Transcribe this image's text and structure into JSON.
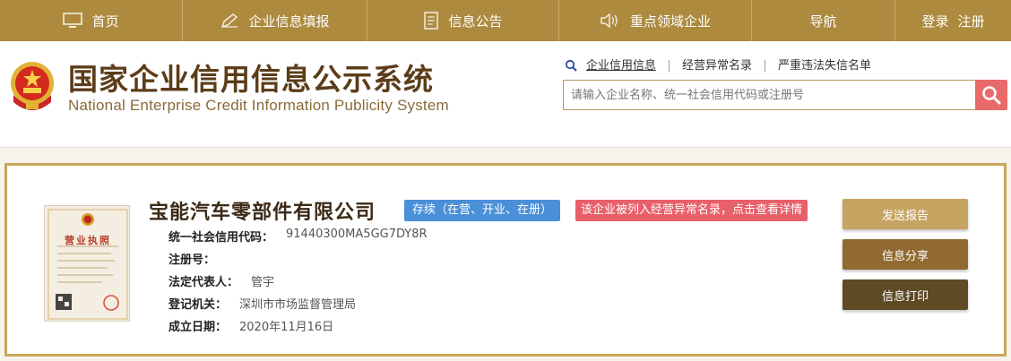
{
  "nav": {
    "home": "首页",
    "fill": "企业信息填报",
    "notice": "信息公告",
    "key": "重点领域企业",
    "guide": "导航",
    "login": "登录",
    "register": "注册"
  },
  "header": {
    "title": "国家企业信用信息公示系统",
    "subtitle": "National Enterprise Credit Information Publicity System",
    "quick_links": [
      "企业信用信息",
      "经营异常名录",
      "严重违法失信名单"
    ],
    "search_placeholder": "请输入企业名称、统一社会信用代码或注册号"
  },
  "company": {
    "name": "宝能汽车零部件有限公司",
    "status_badge": "存续（在营、开业、在册）",
    "warning_badge": "该企业被列入经营异常名录，点击查看详情",
    "license_title": "营业执照",
    "fields": [
      {
        "label": "统一社会信用代码：",
        "value": "91440300MA5GG7DY8R"
      },
      {
        "label": "注册号：",
        "value": ""
      },
      {
        "label": "法定代表人：",
        "value": "管宇"
      },
      {
        "label": "登记机关：",
        "value": "深圳市市场监督管理局"
      },
      {
        "label": "成立日期：",
        "value": "2020年11月16日"
      }
    ]
  },
  "actions": {
    "report": "发送报告",
    "share": "信息分享",
    "print": "信息打印"
  },
  "colors": {
    "nav_bg": "#ad8a3e",
    "status_blue": "#4a8fd8",
    "warning_red": "#e8606a",
    "search_red": "#e86a6a"
  }
}
